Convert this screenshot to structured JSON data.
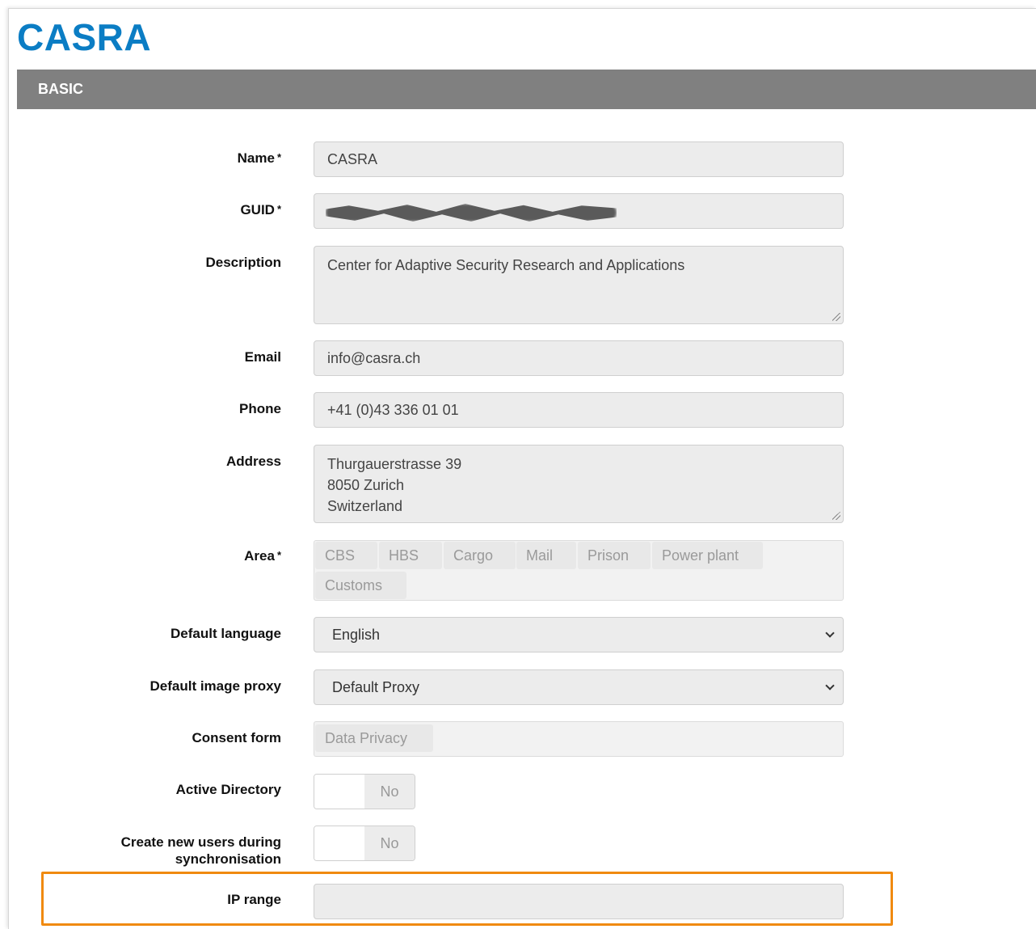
{
  "app": {
    "logo_text": "CASRA",
    "brand_color": "#0b7dc4"
  },
  "section": {
    "title": "BASIC"
  },
  "required_marker": "*",
  "form": {
    "name": {
      "label": "Name",
      "value": "CASRA"
    },
    "guid": {
      "label": "GUID"
    },
    "description": {
      "label": "Description",
      "value": "Center for Adaptive Security Research and Applications"
    },
    "email": {
      "label": "Email",
      "value": "info@casra.ch"
    },
    "phone": {
      "label": "Phone",
      "value": "+41 (0)43 336 01 01"
    },
    "address": {
      "label": "Address",
      "lines": [
        "Thurgauerstrasse 39",
        "8050 Zurich",
        "Switzerland"
      ]
    },
    "area": {
      "label": "Area",
      "tags": [
        "CBS",
        "HBS",
        "Cargo",
        "Mail",
        "Prison",
        "Power plant",
        "Customs"
      ]
    },
    "default_language": {
      "label": "Default language",
      "value": "English"
    },
    "default_image_proxy": {
      "label": "Default image proxy",
      "value": "Default Proxy"
    },
    "consent_form": {
      "label": "Consent form",
      "tags": [
        "Data Privacy"
      ]
    },
    "active_directory": {
      "label": "Active Directory",
      "state": "No"
    },
    "create_users_sync": {
      "label_line1": "Create new users during",
      "label_line2": "synchronisation",
      "state": "No"
    },
    "ip_range": {
      "label": "IP range",
      "value": ""
    }
  },
  "highlight_color": "#f08a10"
}
